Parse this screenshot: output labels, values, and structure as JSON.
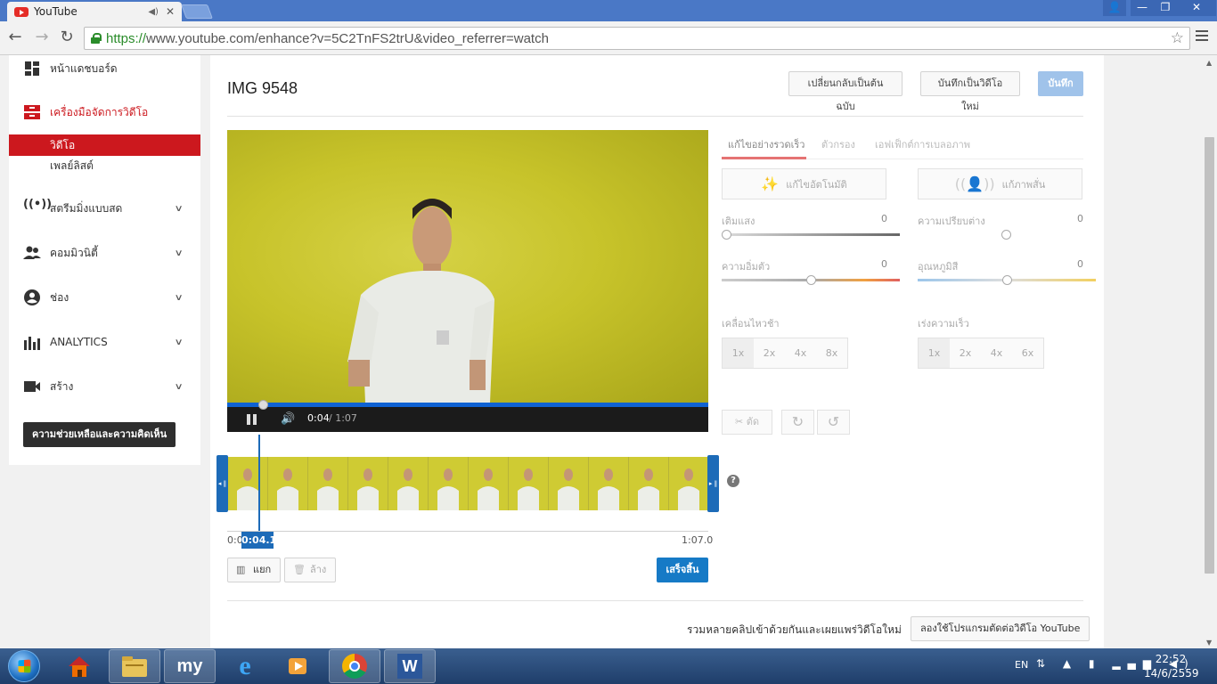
{
  "browser": {
    "tab_title": "YouTube",
    "url_secure": "https://",
    "url_rest": "www.youtube.com/enhance?v=5C2TnFS2trU&video_referrer=watch",
    "icons": [
      "back-icon",
      "forward-icon",
      "reload-icon",
      "lock-icon",
      "star-icon",
      "menu-icon"
    ]
  },
  "sidebar": {
    "dashboard": "หน้าแดชบอร์ด",
    "video_manager": "เครื่องมือจัดการวิดีโอ",
    "videos": "วิดีโอ",
    "playlists": "เพลย์ลิสต์",
    "live": "สตรีมมิ่งแบบสด",
    "community": "คอมมิวนิตี้",
    "channel": "ช่อง",
    "analytics": "ANALYTICS",
    "create": "สร้าง",
    "help_feedback": "ความช่วยเหลือและความคิดเห็น"
  },
  "editor": {
    "title": "IMG 9548",
    "revert": "เปลี่ยนกลับเป็นต้นฉบับ",
    "save_as_new": "บันทึกเป็นวิดีโอใหม่",
    "save": "บันทึก",
    "time_current": "0:04",
    "time_total": " / 1:07",
    "playhead_label": "0:04.1",
    "timeline_start": "0:0",
    "timeline_end": "1:07.0",
    "split": "แยก",
    "clear": "ล้าง",
    "done": "เสร็จสิ้น",
    "help_q": "?"
  },
  "panel": {
    "tabs": [
      "แก้ไขอย่างรวดเร็ว",
      "ตัวกรอง",
      "เอฟเฟ็กต์การเบลอภาพ"
    ],
    "auto_fix": "แก้ไขอัตโนมัติ",
    "stabilize": "แก้ภาพสั่น",
    "fill_light": "เติมแสง",
    "fill_light_val": "0",
    "contrast": "ความเปรียบต่าง",
    "contrast_val": "0",
    "saturation": "ความอิ่มตัว",
    "saturation_val": "0",
    "temperature": "อุณหภูมิสี",
    "temperature_val": "0",
    "slow_motion": "เคลื่อนไหวช้า",
    "slow_opts": [
      "1x",
      "2x",
      "4x",
      "8x"
    ],
    "timelapse": "เร่งความเร็ว",
    "timelapse_opts": [
      "1x",
      "2x",
      "4x",
      "6x"
    ],
    "trim": "ตัด",
    "slider_levels": {
      "fill_light": 0.0,
      "contrast": 0.5,
      "saturation": 0.5,
      "temperature": 0.5
    }
  },
  "footer": {
    "combine_text": "รวมหลายคลิปเข้าด้วยกันและเผยแพร่วิดีโอใหม่",
    "try_editor": "ลองใช้โปรแกรมตัดต่อวิดีโอ YouTube"
  },
  "taskbar": {
    "apps": [
      "start-orb",
      "home-icon",
      "explorer-icon",
      "my-icon",
      "ie-icon",
      "media-player-icon",
      "chrome-icon",
      "word-icon"
    ],
    "lang": "EN",
    "time": "22:52",
    "date": "14/6/2559"
  },
  "colors": {
    "youtube_red": "#cc181e",
    "blue": "#167ac6",
    "titlebar": "#4a78c6"
  }
}
